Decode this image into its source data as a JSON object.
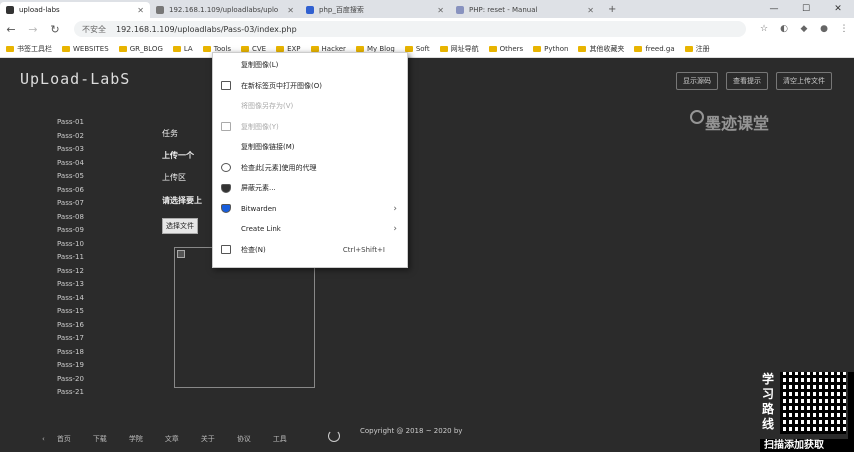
{
  "browser": {
    "tabs": [
      {
        "title": "upload-labs",
        "active": true
      },
      {
        "title": "192.168.1.109/uploadlabs/uplo",
        "active": false
      },
      {
        "title": "php_百度搜索",
        "active": false
      },
      {
        "title": "PHP: reset - Manual",
        "active": false
      }
    ],
    "new_tab": "+",
    "window_controls": [
      "—",
      "☐",
      "✕"
    ],
    "nav": {
      "back": "←",
      "forward": "→",
      "reload": "↻"
    },
    "security": "不安全",
    "url": "192.168.1.109/uploadlabs/Pass-03/index.php",
    "bookmarks": [
      "书签工具栏",
      "WEBSITES",
      "GR_BLOG",
      "LA",
      "Tools",
      "CVE",
      "EXP",
      "Hacker",
      "My Blog",
      "Soft",
      "网址导航",
      "Others",
      "Python",
      "其他收藏夹",
      "freed.ga",
      "注册"
    ]
  },
  "page": {
    "logo": "UpLoad-LabS",
    "top_buttons": [
      "显示源码",
      "查看提示",
      "清空上传文件"
    ],
    "pass_items": [
      "Pass-01",
      "Pass-02",
      "Pass-03",
      "Pass-04",
      "Pass-05",
      "Pass-06",
      "Pass-07",
      "Pass-08",
      "Pass-09",
      "Pass-10",
      "Pass-11",
      "Pass-12",
      "Pass-13",
      "Pass-14",
      "Pass-15",
      "Pass-16",
      "Pass-17",
      "Pass-18",
      "Pass-19",
      "Pass-20",
      "Pass-21"
    ],
    "task_title": "任务",
    "task_text": "上传一个",
    "upload_area": "上传区",
    "select_hint": "请选择要上",
    "file_button": "选择文件",
    "footer_nav": [
      "首页",
      "下载",
      "学院",
      "文章",
      "关于",
      "协议",
      "工具"
    ],
    "copyright": "Copyright @ 2018 ~ 2020 by"
  },
  "context_menu": {
    "items": [
      {
        "label": "复制图像(L)",
        "disabled": false,
        "icon": "blank"
      },
      {
        "label": "在新标签页中打开图像(O)",
        "disabled": false,
        "icon": "image-icon"
      },
      {
        "label": "将图像另存为(V)",
        "disabled": true,
        "icon": "blank"
      },
      {
        "label": "复制图像(Y)",
        "disabled": true,
        "icon": "copy-icon"
      },
      {
        "label": "复制图像链接(M)",
        "disabled": false,
        "icon": "blank"
      },
      {
        "label": "检查此[元素]使用的代理",
        "disabled": false,
        "icon": "gear-icon"
      },
      {
        "label": "屏蔽元素...",
        "disabled": false,
        "icon": "shield-icon"
      },
      {
        "label": "Bitwarden",
        "disabled": false,
        "icon": "shield-icon",
        "submenu": true
      },
      {
        "label": "Create Link",
        "disabled": false,
        "icon": "blank",
        "submenu": true
      },
      {
        "label": "检查(N)",
        "disabled": false,
        "icon": "inspect-icon",
        "shortcut": "Ctrl+Shift+I"
      }
    ]
  },
  "overlay": {
    "watermark": "墨迹课堂",
    "qr_side": [
      "学",
      "习",
      "路",
      "线"
    ],
    "qr_bottom": "扫描添加获取"
  }
}
